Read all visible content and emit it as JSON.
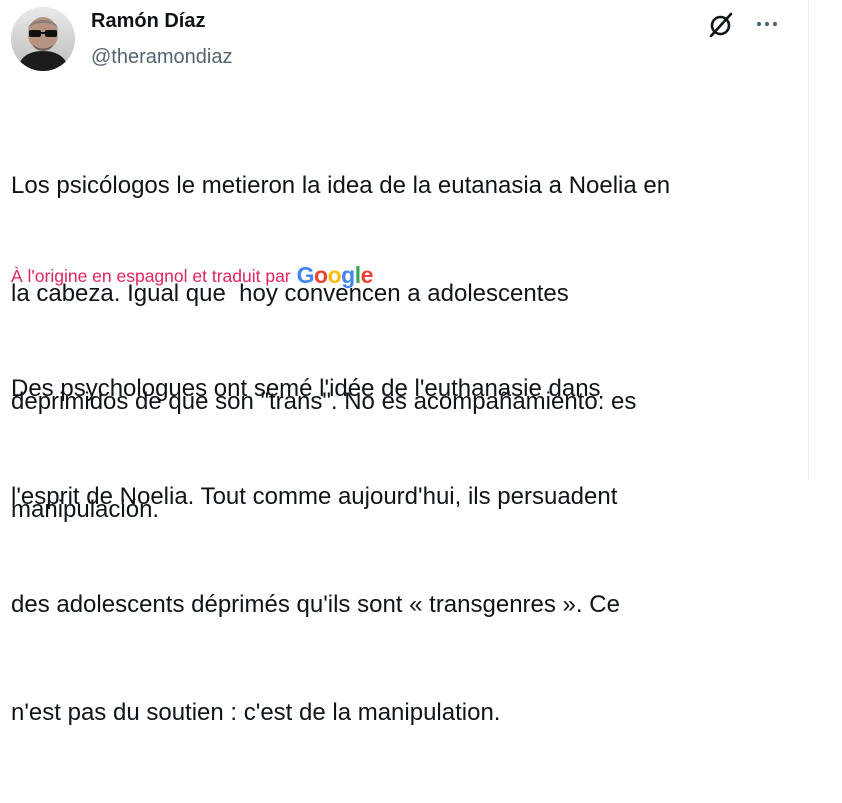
{
  "author": {
    "name": "Ramón Díaz",
    "handle": "@theramondiaz"
  },
  "icons": {
    "grok": "grok-icon",
    "more": "more-horizontal-icon"
  },
  "tweet": {
    "lines": [
      "Los psicólogos le metieron la idea de la eutanasia a Noelia en",
      "la cabeza. Igual que  hoy convencen a adolescentes",
      "deprimidos de que son \"trans\". No es acompañamiento: es",
      "manipulación."
    ]
  },
  "translation": {
    "label": "À l'origine en espagnol et traduit par",
    "provider_letters": [
      "G",
      "o",
      "o",
      "g",
      "l",
      "e"
    ],
    "provider_colors": [
      "#4285F4",
      "#EA4335",
      "#FBBC05",
      "#4285F4",
      "#34A853",
      "#EA4335"
    ],
    "label_color": "#e0245e",
    "lines": [
      "Des psychologues ont semé l'idée de l'euthanasie dans",
      "l'esprit de Noelia. Tout comme aujourd'hui, ils persuadent",
      "des adolescents déprimés qu'ils sont « transgenres ». Ce",
      "n'est pas du soutien : c'est de la manipulation."
    ]
  }
}
